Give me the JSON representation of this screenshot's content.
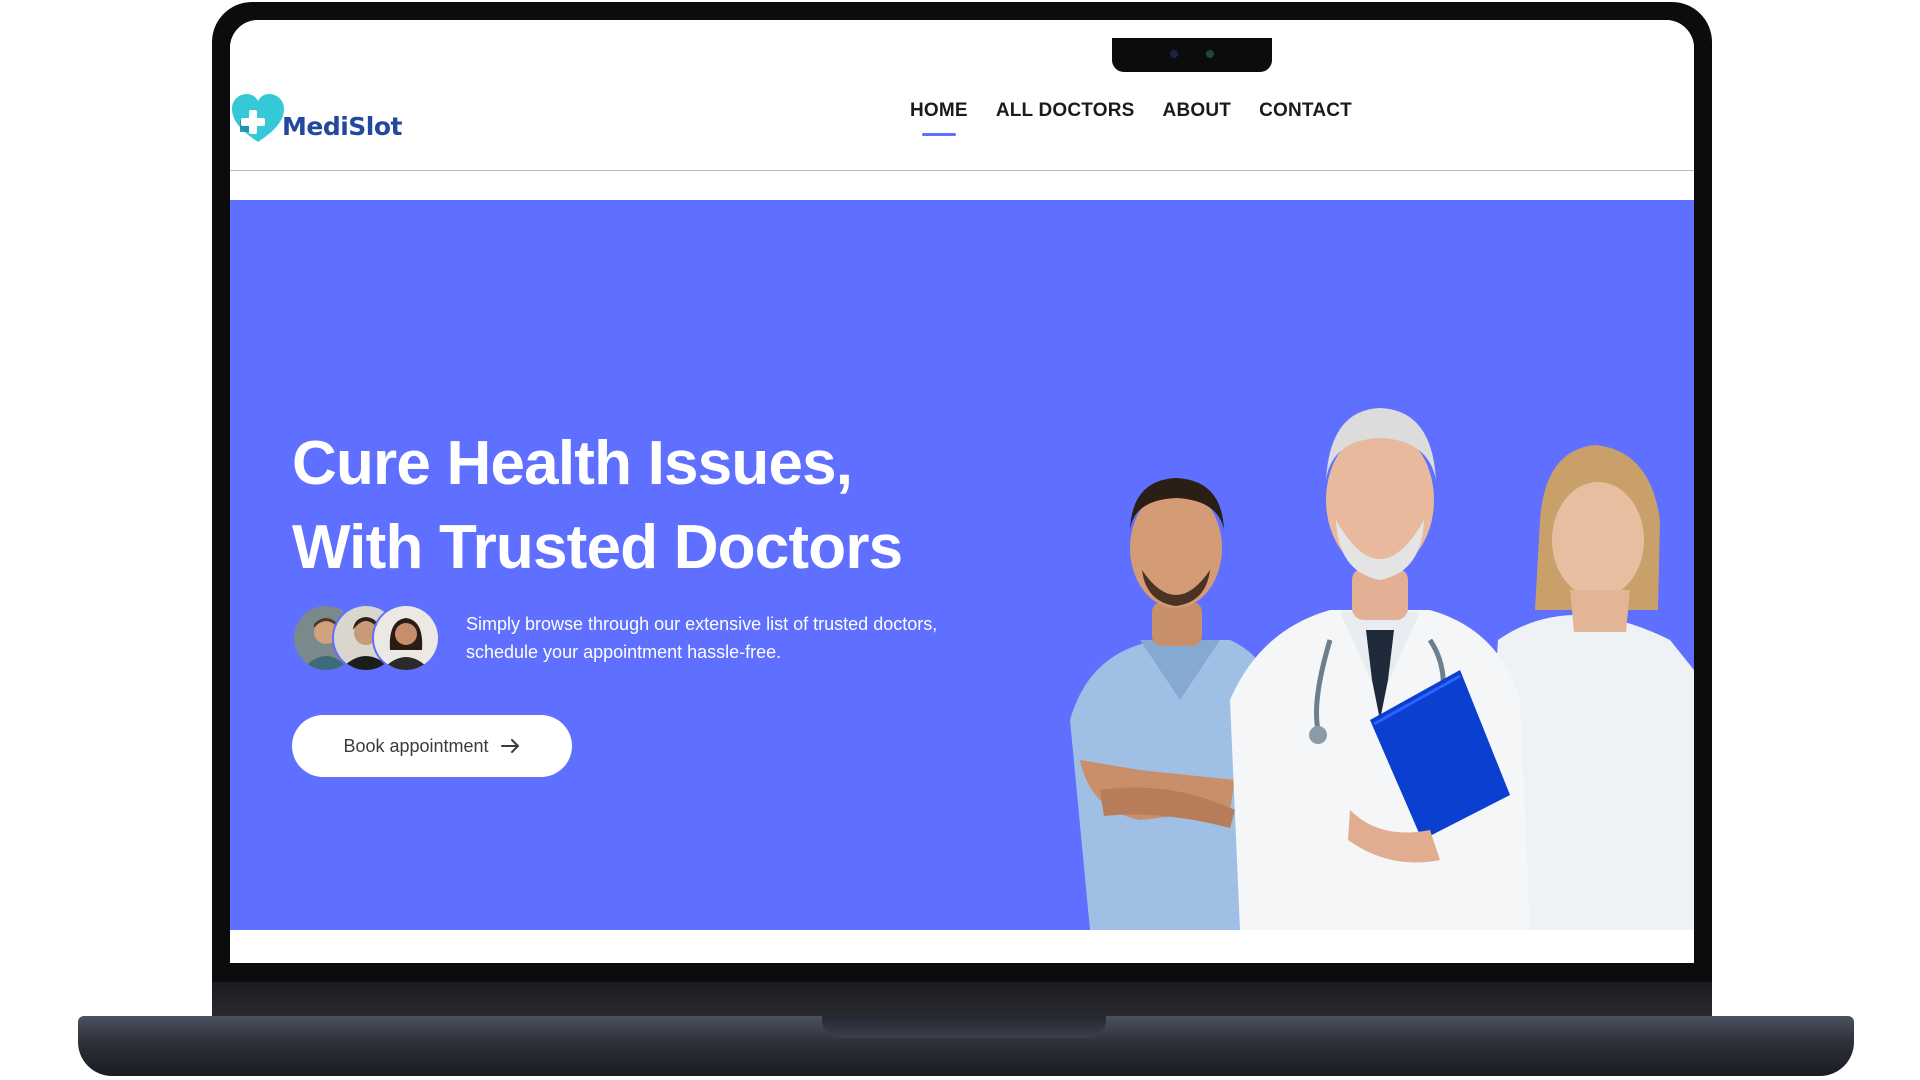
{
  "brand": {
    "name": "MediSlot"
  },
  "nav": {
    "items": [
      {
        "label": "HOME",
        "active": true
      },
      {
        "label": "ALL DOCTORS",
        "active": false
      },
      {
        "label": "ABOUT",
        "active": false
      },
      {
        "label": "CONTACT",
        "active": false
      }
    ]
  },
  "hero": {
    "title_line1": "Cure Health Issues,",
    "title_line2": "With Trusted Doctors",
    "description_line1": "Simply browse through our extensive list of trusted doctors,",
    "description_line2": "schedule your appointment hassle-free.",
    "cta_label": "Book appointment",
    "cta_icon": "arrow-right-icon",
    "avatars": [
      "user-avatar-1",
      "user-avatar-2",
      "user-avatar-3"
    ]
  },
  "colors": {
    "primary": "#5f6fff",
    "brand_text": "#24489c",
    "logo_accent": "#35c8d6",
    "nav_text": "#1b1b1b"
  }
}
